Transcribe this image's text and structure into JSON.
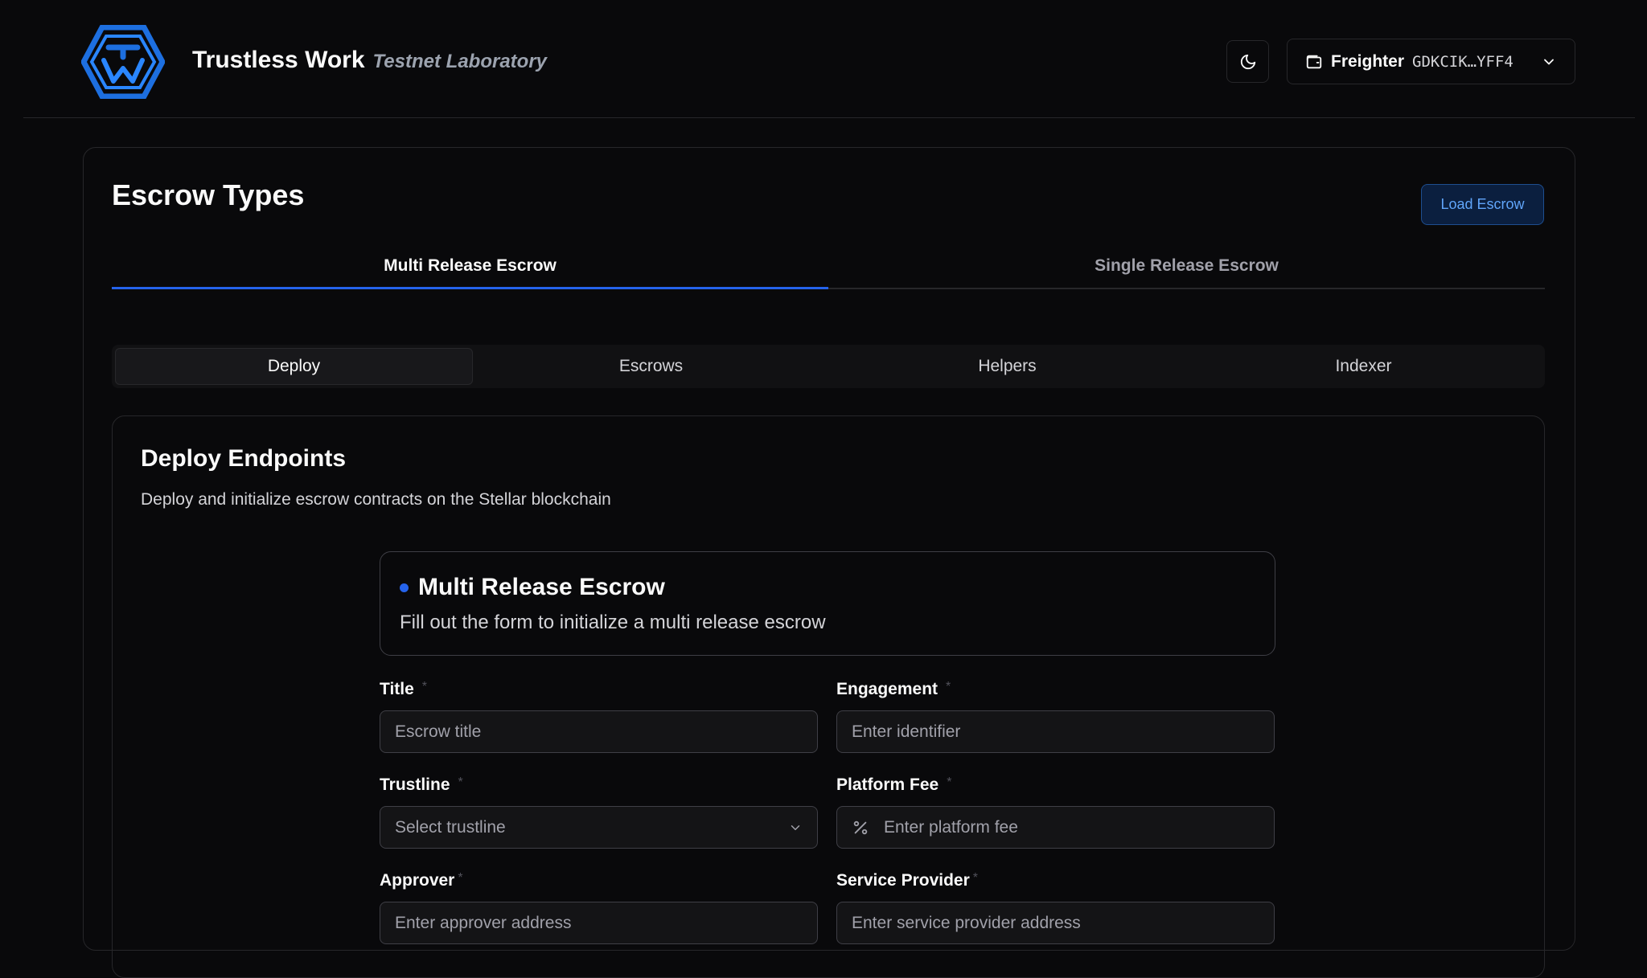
{
  "header": {
    "brand_name": "Trustless Work",
    "brand_sub": "Testnet Laboratory",
    "theme_icon": "moon-icon",
    "wallet": {
      "icon": "wallet-icon",
      "name": "Freighter",
      "address": "GDKCIK…YFF4"
    }
  },
  "panel": {
    "title": "Escrow Types",
    "load_button": "Load Escrow",
    "type_tabs": [
      {
        "label": "Multi Release Escrow",
        "active": true
      },
      {
        "label": "Single Release Escrow",
        "active": false
      }
    ],
    "sub_tabs": [
      {
        "label": "Deploy",
        "active": true
      },
      {
        "label": "Escrows",
        "active": false
      },
      {
        "label": "Helpers",
        "active": false
      },
      {
        "label": "Indexer",
        "active": false
      }
    ]
  },
  "deploy": {
    "title": "Deploy Endpoints",
    "description": "Deploy and initialize escrow contracts on the Stellar blockchain",
    "form_title": "Multi Release Escrow",
    "form_description": "Fill out the form to initialize a multi release escrow",
    "required_mark": "*",
    "fields": {
      "title": {
        "label": "Title",
        "placeholder": "Escrow title"
      },
      "engagement": {
        "label": "Engagement",
        "placeholder": "Enter identifier"
      },
      "trustline": {
        "label": "Trustline",
        "placeholder": "Select trustline"
      },
      "platform_fee": {
        "label": "Platform Fee",
        "placeholder": "Enter platform fee"
      },
      "approver": {
        "label": "Approver",
        "placeholder": "Enter approver address"
      },
      "service_provider": {
        "label": "Service Provider",
        "placeholder": "Enter service provider address"
      }
    }
  },
  "colors": {
    "background": "#09090b",
    "accent": "#2563eb",
    "border": "#27272a"
  }
}
